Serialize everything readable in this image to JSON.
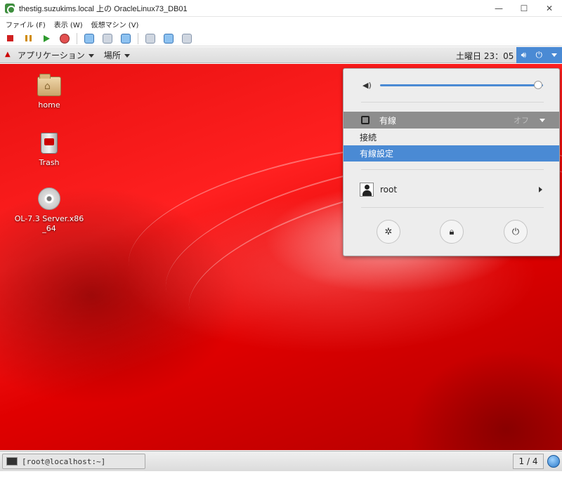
{
  "window": {
    "title": "thestig.suzukims.local 上の OracleLinux73_DB01",
    "controls": {
      "minimize": "—",
      "maximize": "☐",
      "close": "✕"
    }
  },
  "menubar": {
    "items": [
      "ファイル (F)",
      "表示 (W)",
      "仮想マシン (V)"
    ]
  },
  "toolbar": {
    "icons": [
      "stop-icon",
      "pause-icon",
      "start-icon",
      "reset-icon",
      "snapshot-icon",
      "revert-icon",
      "manage-snapshot-icon",
      "ctrl-alt-del-icon",
      "settings-icon",
      "connect-icon"
    ]
  },
  "guest_panel": {
    "apps_label": "アプリケーション",
    "places_label": "場所",
    "clock": "土曜日 23：05"
  },
  "desktop": {
    "icons": [
      {
        "label": "home",
        "icon": "home-folder-icon"
      },
      {
        "label": "Trash",
        "icon": "trash-icon"
      },
      {
        "label": "OL-7.3 Server.x86_64",
        "icon": "dvd-icon"
      }
    ]
  },
  "system_menu": {
    "volume_level": 0.97,
    "wired": {
      "label": "有線",
      "state": "オフ"
    },
    "submenu": [
      {
        "label": "接続",
        "selected": false
      },
      {
        "label": "有線設定",
        "selected": true
      }
    ],
    "user": {
      "name": "root"
    },
    "actions": [
      "settings-icon",
      "lock-icon",
      "power-icon"
    ]
  },
  "bottom_panel": {
    "task_label": "[root@localhost:~]",
    "workspace": "1 / 4"
  },
  "colors": {
    "accent": "#4a8ad4",
    "desktop_red": "#e00000",
    "panel_bg": "#ededed"
  }
}
